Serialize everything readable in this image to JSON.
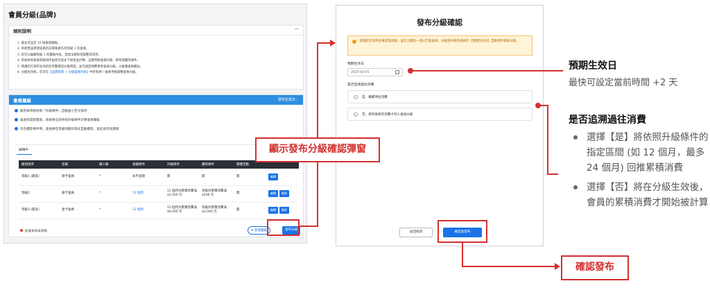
{
  "admin": {
    "title": "會員分級(品牌)",
    "rules": {
      "title": "規則說明",
      "collapse": "−",
      "items": [
        "1. 最多可設定 10 個會員層級。",
        "2. 系統預設將現成員的註冊會員作為等級 1 的會員。",
        "3. 您可以編輯等級 1 的層級內容，但無法刪除或調整其排序。",
        "4. 系統依照會員等級排序由高至低往下檢查並計算，自動判斷會員升級、降等或續等條件。",
        "5. 建議您在發布生效前的完整確認分級制度，並勿過度頻繁更新會員分級，以維護會員權益。",
        "6. 分級生效後，您可在"
      ],
      "item6_link": "【品牌管理 > 分級會員列表】",
      "item6_tail": "中針對單一會員手動調整會員分級。"
    },
    "tiers": {
      "title": "會員層級",
      "effective": "發布生效日：",
      "notes": [
        "級別排序將依照「升級條件」自動由小至大排序",
        "會員完成結帳後，系統將立即依照升級條件計算會員層級",
        "符合續等條件時，會員將在等級到期日隔天自動續等，並延長有效期限"
      ],
      "tab": "編輯中",
      "headers": [
        "級別排序",
        "名稱",
        "總人數",
        "會籍條件",
        "升級條件",
        "續等條件",
        "贈禮活動",
        ""
      ],
      "rows": [
        {
          "order": "等級1 (最低)",
          "name": "銅卡會員",
          "count": "*",
          "term": "永不過期",
          "up": "無",
          "renew": "無",
          "gift": "無",
          "edit": "編輯",
          "del": ""
        },
        {
          "order": "等級2",
          "name": "銀卡會員",
          "count": "*",
          "term": "12 個月",
          "up": "12 個月內累積消費滿 $1,500 元",
          "renew": "等級內累積消費滿 $500 元",
          "gift": "無",
          "edit": "編輯",
          "del": "刪除"
        },
        {
          "order": "等級3 (最高)",
          "name": "金卡會員",
          "count": "*",
          "term": "12 個月",
          "up": "12 個月內累積消費滿 $6,000 元",
          "renew": "等級內累積消費滿 $2,000 元",
          "gift": "無",
          "edit": "編輯",
          "del": "刪除"
        }
      ],
      "warn": "此版本尚未發佈",
      "add": "新增層級",
      "publish": "發布分級"
    }
  },
  "modal": {
    "title": "發布分級確認",
    "alert": "建議您在發布前確認當前級，並在之體前一週公告給會員；分級發布後系統將於【預期生效日】自動更新會員分級。",
    "date_label": "預期生效日",
    "date_value": "2025-02-01",
    "retro_label": "是否追溯過往消費",
    "options": [
      "是，繼續溯往消費",
      "否，發布後新的消費才列入會員分級"
    ],
    "cancel": "返回修改",
    "confirm": "確認並發布"
  },
  "callouts": {
    "show_modal": "顯示發布分級確認彈窗",
    "confirm_publish": "確認發布",
    "date_title": "預期生效日",
    "date_desc": "最快可設定當前時間 +2 天",
    "retro_title": "是否追溯過往消費",
    "retro_items": [
      "選擇【是】將依照升級條件的指定區間 (如 12 個月，最多 24 個月) 回推累積消費",
      "選擇【否】將在分級生效後，會員的累積消費才開始被計算"
    ]
  },
  "colors": {
    "accent": "#1a73e8",
    "header_blue": "#2d8fe0",
    "callout_red": "#d32f2f",
    "warning": "#f0a020"
  }
}
